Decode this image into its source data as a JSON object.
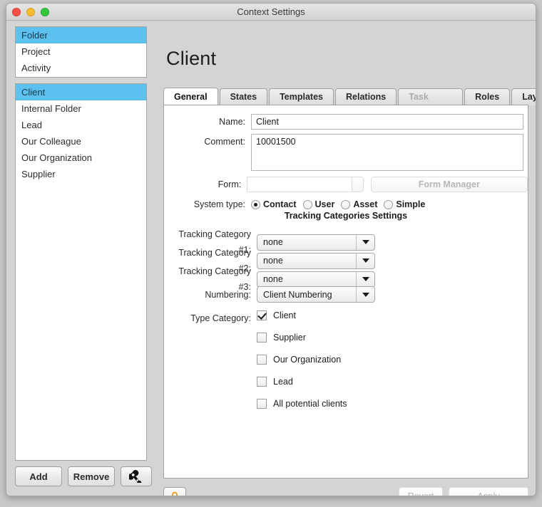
{
  "window": {
    "title": "Context Settings",
    "controls": {
      "close": "close-button",
      "minimize": "minimize-button",
      "maximize": "maximize-button"
    }
  },
  "sidebar": {
    "top_list": [
      {
        "label": "Folder",
        "selected": true
      },
      {
        "label": "Project",
        "selected": false
      },
      {
        "label": "Activity",
        "selected": false
      }
    ],
    "bottom_list": [
      {
        "label": "Client",
        "selected": true
      },
      {
        "label": "Internal Folder",
        "selected": false
      },
      {
        "label": "Lead",
        "selected": false
      },
      {
        "label": "Our Colleague",
        "selected": false
      },
      {
        "label": "Our Organization",
        "selected": false
      },
      {
        "label": "Supplier",
        "selected": false
      }
    ],
    "toolbar": {
      "add_label": "Add",
      "remove_label": "Remove",
      "tool_icon": "wrench-icon"
    }
  },
  "content": {
    "page_title": "Client",
    "tabs": [
      {
        "label": "General",
        "active": true,
        "disabled": false
      },
      {
        "label": "States",
        "active": false,
        "disabled": false
      },
      {
        "label": "Templates",
        "active": false,
        "disabled": false
      },
      {
        "label": "Relations",
        "active": false,
        "disabled": false
      },
      {
        "label": "Task Templates",
        "active": false,
        "disabled": true
      },
      {
        "label": "Roles",
        "active": false,
        "disabled": false
      },
      {
        "label": "Layout",
        "active": false,
        "disabled": false
      }
    ],
    "general": {
      "name_label": "Name:",
      "name_value": "Client",
      "name_placeholder": "",
      "comment_label": "Comment:",
      "comment_value": "10001500",
      "comment_placeholder": "",
      "form_label": "Form:",
      "form_value": "",
      "form_placeholder": "",
      "form_manager_label": "Form Manager",
      "system_type_label": "System type:",
      "system_type_options": [
        {
          "label": "Contact",
          "checked": true
        },
        {
          "label": "User",
          "checked": false
        },
        {
          "label": "Asset",
          "checked": false
        },
        {
          "label": "Simple",
          "checked": false
        }
      ],
      "tracking_heading": "Tracking Categories Settings",
      "tracking_rows": [
        {
          "label": "Tracking Category #1:",
          "value": "none"
        },
        {
          "label": "Tracking Category #2:",
          "value": "none"
        },
        {
          "label": "Tracking Category #3:",
          "value": "none"
        }
      ],
      "numbering_label": "Numbering:",
      "numbering_value": "Client Numbering",
      "type_category_label": "Type Category:",
      "type_categories": [
        {
          "label": "Client",
          "checked": true
        },
        {
          "label": "Supplier",
          "checked": false
        },
        {
          "label": "Our Organization",
          "checked": false
        },
        {
          "label": "Lead",
          "checked": false
        },
        {
          "label": "All potential clients",
          "checked": false
        }
      ]
    },
    "bottom_bar": {
      "lock_icon": "lock-icon",
      "revert_label": "Revert",
      "apply_label": "Apply"
    }
  },
  "colors": {
    "selection": "#5dc1f0",
    "window_bg": "#d4d4d4",
    "panel_bg": "#ffffff",
    "lock_accent": "#f09a1e"
  }
}
